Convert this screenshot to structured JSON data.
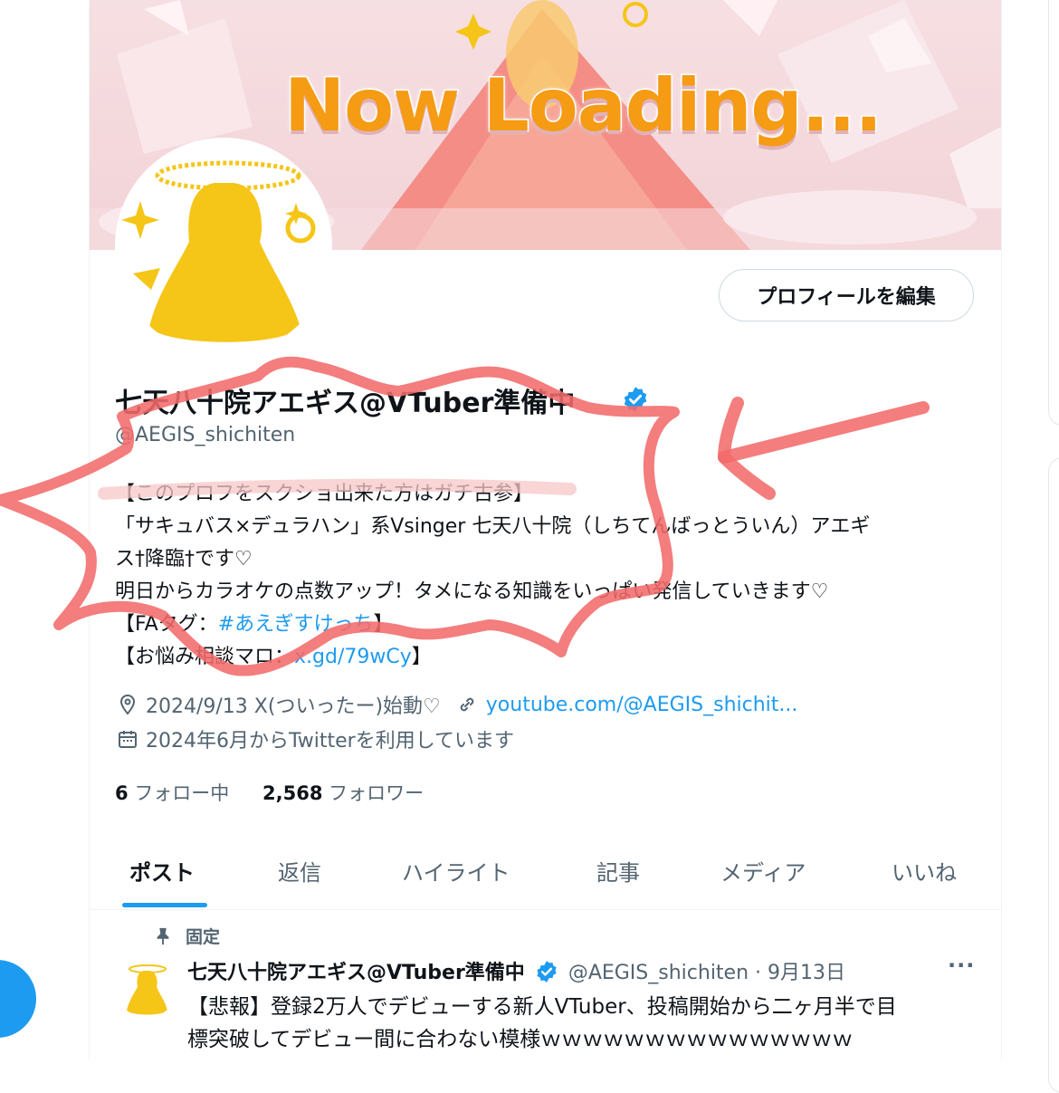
{
  "banner": {
    "text": "Now Loading..."
  },
  "profile": {
    "edit_button": "プロフィールを編集",
    "display_name": "七天八十院アエギス@VTuber準備中",
    "handle": "@AEGIS_shichiten",
    "bio": {
      "line1": "【このプロフをスクショ出来た方はガチ古参】",
      "line2": "「サキュバス×デュラハン」系Vsinger 七天八十院（しちてんばっとういん）アエギ",
      "line3": "ス†降臨†です♡",
      "line4": " 明日からカラオケの点数アップ！タメになる知識をいっぱい発信していきます♡",
      "line5_prefix": "【FAタグ：",
      "line5_link": "#あえぎすけっち",
      "line5_suffix": "】",
      "line6_prefix": "【お悩み相談マロ：",
      "line6_link": "x.gd/79wCy",
      "line6_suffix": "】"
    },
    "location": "2024/9/13 X(ついったー)始動♡",
    "website": "youtube.com/@AEGIS_shichit...",
    "joined": "2024年6月からTwitterを利用しています",
    "following_count": "6",
    "following_label": "フォロー中",
    "followers_count": "2,568",
    "followers_label": "フォロワー"
  },
  "tabs": [
    "ポスト",
    "返信",
    "ハイライト",
    "記事",
    "メディア",
    "いいね"
  ],
  "pinned_tweet": {
    "pinned_label": "固定",
    "name": "七天八十院アエギス@VTuber準備中",
    "handle_date": "@AEGIS_shichiten · 9月13日",
    "more": "···",
    "text_line1": "【悲報】登録2万人でデビューする新人VTuber、投稿開始から二ヶ月半で目",
    "text_line2": "標突破してデビュー間に合わない模様ｗｗｗｗｗｗｗｗｗｗｗｗｗｗｗ"
  },
  "colors": {
    "accent": "#1d9bf0",
    "banner_text": "#f59b14",
    "avatar_silhouette": "#f5c518",
    "annotation": "#f26b6b"
  }
}
